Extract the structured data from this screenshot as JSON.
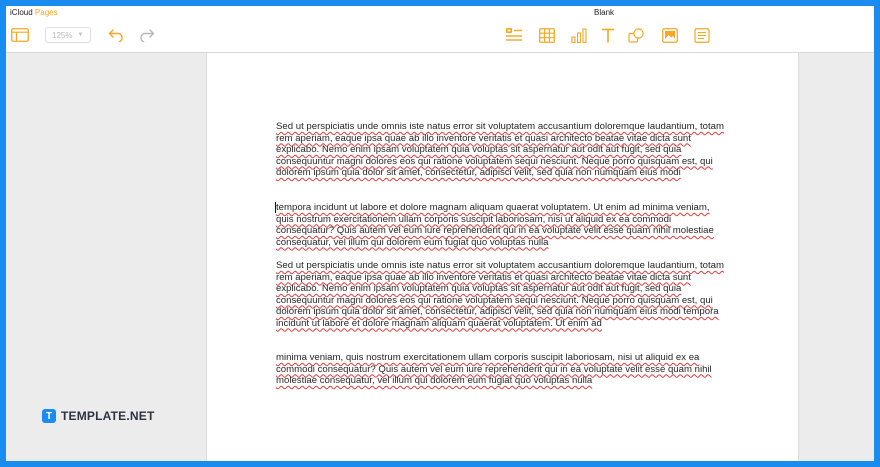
{
  "app": {
    "name": "iCloud",
    "product": "Pages"
  },
  "document": {
    "title": "Blank"
  },
  "toolbar": {
    "zoom": "125%",
    "icons": {
      "accent": "#f5a623",
      "muted": "#9aa6b2"
    }
  },
  "body": {
    "paragraphs": [
      "Sed ut perspiciatis unde omnis iste natus error sit voluptatem accusantium doloremque laudantium, totam rem aperiam, eaque ipsa quae ab illo inventore veritatis et quasi architecto beatae vitae dicta sunt explicabo. Nemo enim ipsam voluptatem quia voluptas sit aspernatur aut odit aut fugit, sed quia consequuntur magni dolores eos qui ratione voluptatem sequi nesciunt. Neque porro quisquam est, qui dolorem ipsum quia dolor sit amet, consectetur, adipisci velit, sed quia non numquam eius modi",
      "tempora incidunt ut labore et dolore magnam aliquam quaerat voluptatem. Ut enim ad minima veniam, quis nostrum exercitationem ullam corporis suscipit laboriosam, nisi ut aliquid ex ea commodi consequatur? Quis autem vel eum iure reprehenderit qui in ea voluptate velit esse quam nihil molestiae consequatur, vel illum qui dolorem eum fugiat quo voluptas nulla",
      "Sed ut perspiciatis unde omnis iste natus error sit voluptatem accusantium doloremque laudantium, totam rem aperiam, eaque ipsa quae ab illo inventore veritatis et quasi architecto beatae vitae dicta sunt explicabo. Nemo enim ipsam voluptatem quia voluptas sit aspernatur aut odit aut fugit, sed quia consequuntur magni dolores eos qui ratione voluptatem sequi nesciunt. Neque porro quisquam est, qui dolorem ipsum quia dolor sit amet, consectetur, adipisci velit, sed quia non numquam eius modi tempora incidunt ut labore et dolore magnam aliquam quaerat voluptatem. Ut enim ad",
      "minima veniam, quis nostrum exercitationem ullam corporis suscipit laboriosam, nisi ut aliquid ex ea commodi consequatur? Quis autem vel eum iure reprehenderit qui in ea voluptate velit esse quam nihil molestiae consequatur, vel illum qui dolorem eum fugiat quo voluptas nulla"
    ]
  },
  "watermark": {
    "logo_letter": "T",
    "text": "TEMPLATE.NET"
  }
}
